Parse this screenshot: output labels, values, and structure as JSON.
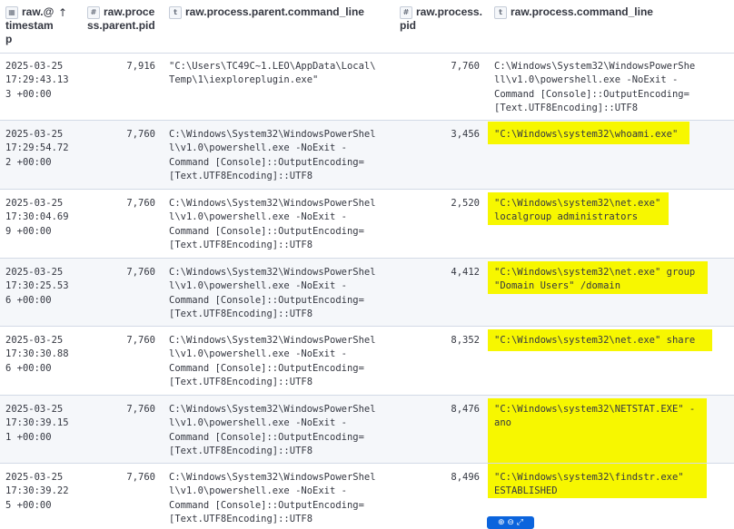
{
  "columns": [
    {
      "icon": "calendar-icon",
      "glyph": "▦",
      "label_lines": [
        "raw.@",
        "timestam",
        "p"
      ]
    },
    {
      "icon": "number-icon",
      "glyph": "#",
      "label_lines": [
        "raw.proce",
        "ss.parent.pid"
      ]
    },
    {
      "icon": "text-icon",
      "glyph": "t",
      "label_lines": [
        "raw.process.parent.command_line"
      ]
    },
    {
      "icon": "number-icon",
      "glyph": "#",
      "label_lines": [
        "raw.process.",
        "pid"
      ]
    },
    {
      "icon": "text-icon",
      "glyph": "t",
      "label_lines": [
        "raw.process.command_line"
      ]
    }
  ],
  "sort_arrow": "↑",
  "rows": [
    {
      "ts": "2025-03-25\n17:29:43.13\n3 +00:00",
      "ppid": "7,916",
      "pcmd": "\"C:\\Users\\TC49C~1.LEO\\AppData\\Local\\\nTemp\\1\\iexploreplugin.exe\"",
      "pid": "7,760",
      "cmd": "C:\\Windows\\System32\\WindowsPowerShe\nll\\v1.0\\powershell.exe -NoExit -\nCommand [Console]::OutputEncoding=\n[Text.UTF8Encoding]::UTF8",
      "highlight": false
    },
    {
      "ts": "2025-03-25\n17:29:54.72\n2 +00:00",
      "ppid": "7,760",
      "pcmd": "C:\\Windows\\System32\\WindowsPowerShel\nl\\v1.0\\powershell.exe -NoExit -\nCommand [Console]::OutputEncoding=\n[Text.UTF8Encoding]::UTF8",
      "pid": "3,456",
      "cmd": "\"C:\\Windows\\system32\\whoami.exe\"",
      "highlight": true
    },
    {
      "ts": "2025-03-25\n17:30:04.69\n9 +00:00",
      "ppid": "7,760",
      "pcmd": "C:\\Windows\\System32\\WindowsPowerShel\nl\\v1.0\\powershell.exe -NoExit -\nCommand [Console]::OutputEncoding=\n[Text.UTF8Encoding]::UTF8",
      "pid": "2,520",
      "cmd": "\"C:\\Windows\\system32\\net.exe\"\nlocalgroup administrators",
      "highlight": true
    },
    {
      "ts": "2025-03-25\n17:30:25.53\n6 +00:00",
      "ppid": "7,760",
      "pcmd": "C:\\Windows\\System32\\WindowsPowerShel\nl\\v1.0\\powershell.exe -NoExit -\nCommand [Console]::OutputEncoding=\n[Text.UTF8Encoding]::UTF8",
      "pid": "4,412",
      "cmd": "\"C:\\Windows\\system32\\net.exe\" group\n\"Domain Users\" /domain",
      "highlight": true
    },
    {
      "ts": "2025-03-25\n17:30:30.88\n6 +00:00",
      "ppid": "7,760",
      "pcmd": "C:\\Windows\\System32\\WindowsPowerShel\nl\\v1.0\\powershell.exe -NoExit -\nCommand [Console]::OutputEncoding=\n[Text.UTF8Encoding]::UTF8",
      "pid": "8,352",
      "cmd": "\"C:\\Windows\\system32\\net.exe\" share",
      "highlight": true
    },
    {
      "ts": "2025-03-25\n17:30:39.15\n1 +00:00",
      "ppid": "7,760",
      "pcmd": "C:\\Windows\\System32\\WindowsPowerShel\nl\\v1.0\\powershell.exe -NoExit -\nCommand [Console]::OutputEncoding=\n[Text.UTF8Encoding]::UTF8",
      "pid": "8,476",
      "cmd": "\"C:\\Windows\\system32\\NETSTAT.EXE\" -\nano",
      "highlight": true
    },
    {
      "ts": "2025-03-25\n17:30:39.22\n5 +00:00",
      "ppid": "7,760",
      "pcmd": "C:\\Windows\\System32\\WindowsPowerShel\nl\\v1.0\\powershell.exe -NoExit -\nCommand [Console]::OutputEncoding=\n[Text.UTF8Encoding]::UTF8",
      "pid": "8,496",
      "cmd": "\"C:\\Windows\\system32\\findstr.exe\"\nESTABLISHED",
      "highlight": true
    }
  ],
  "toolbar_glyphs": "⊕ ⊖ ⤢",
  "colors": {
    "highlight": "#f7f700",
    "border": "#d3dae6",
    "stripe": "#f5f7fa",
    "toolbar": "#0b64dd"
  }
}
